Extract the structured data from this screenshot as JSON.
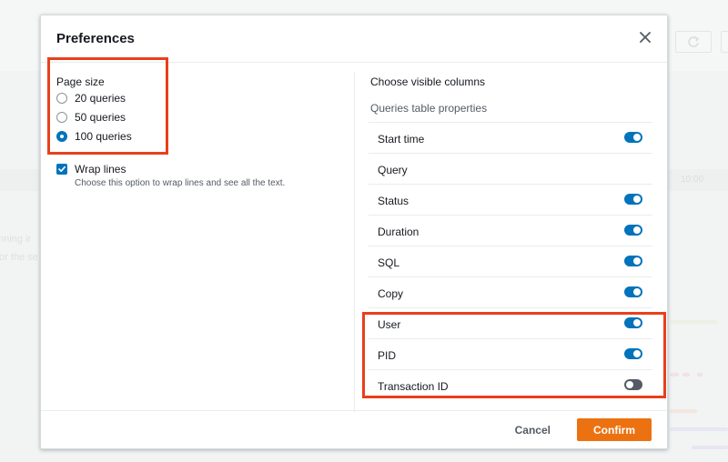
{
  "background": {
    "time_label": "10:00",
    "text_line_1": "nning ir",
    "text_line_2": "or the se"
  },
  "modal": {
    "title": "Preferences",
    "close_icon": "close-icon"
  },
  "page_size": {
    "label": "Page size",
    "options": [
      {
        "label": "20 queries",
        "checked": false
      },
      {
        "label": "50 queries",
        "checked": false
      },
      {
        "label": "100 queries",
        "checked": true
      }
    ]
  },
  "wrap_lines": {
    "label": "Wrap lines",
    "description": "Choose this option to wrap lines and see all the text.",
    "checked": true
  },
  "columns": {
    "title": "Choose visible columns",
    "subtitle": "Queries table properties",
    "items": [
      {
        "label": "Start time",
        "toggle": true,
        "enabled": true
      },
      {
        "label": "Query",
        "toggle": false,
        "enabled": true
      },
      {
        "label": "Status",
        "toggle": true,
        "enabled": true
      },
      {
        "label": "Duration",
        "toggle": true,
        "enabled": true
      },
      {
        "label": "SQL",
        "toggle": true,
        "enabled": true
      },
      {
        "label": "Copy",
        "toggle": true,
        "enabled": true
      },
      {
        "label": "User",
        "toggle": true,
        "enabled": true
      },
      {
        "label": "PID",
        "toggle": true,
        "enabled": true
      },
      {
        "label": "Transaction ID",
        "toggle": true,
        "enabled": false
      }
    ]
  },
  "footer": {
    "cancel_label": "Cancel",
    "confirm_label": "Confirm"
  },
  "colors": {
    "accent": "#0073bb",
    "primary_button": "#ec7211",
    "highlight": "#e8401c"
  }
}
